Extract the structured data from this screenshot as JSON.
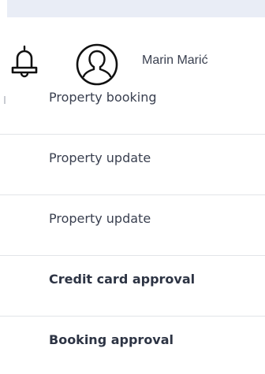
{
  "header": {
    "bell_icon": "bell-icon",
    "avatar_icon": "user-avatar-icon",
    "user_name": "Marin Marić"
  },
  "notifications": [
    {
      "label": "Property booking",
      "unread": false
    },
    {
      "label": "Property update",
      "unread": false
    },
    {
      "label": "Property update",
      "unread": false
    },
    {
      "label": "Credit card approval",
      "unread": true
    },
    {
      "label": "Booking approval",
      "unread": true
    }
  ],
  "colors": {
    "top_strip": "#e9edf6",
    "text": "#3a4050",
    "divider": "#e2e4e8"
  }
}
